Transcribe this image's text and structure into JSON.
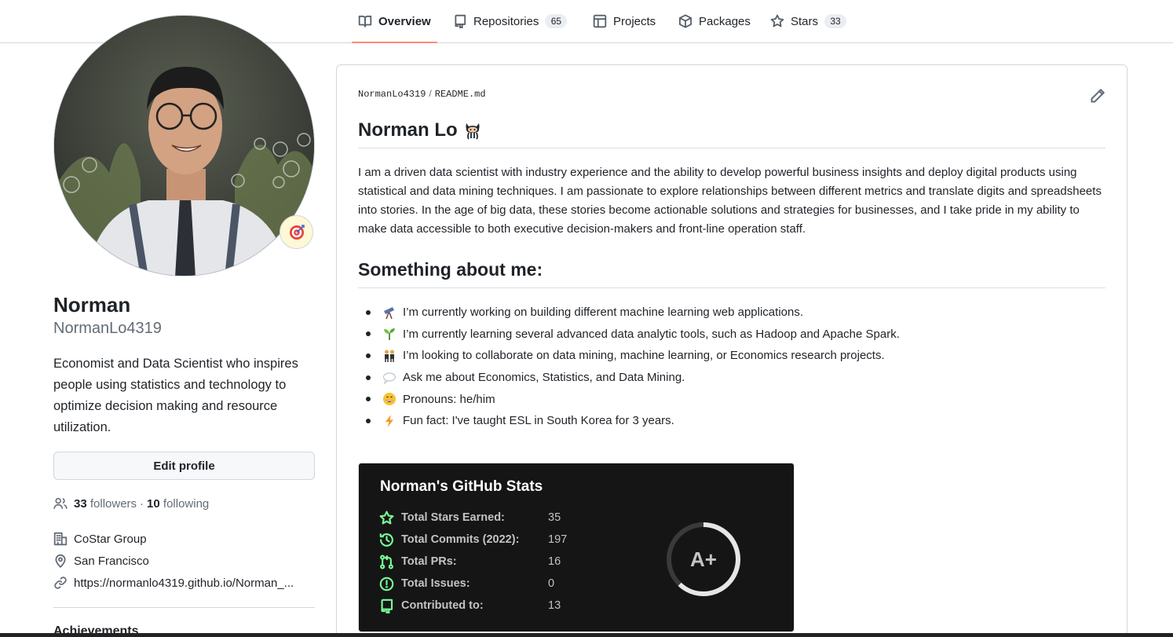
{
  "nav": {
    "tabs": [
      {
        "label": "Overview",
        "icon": "book-icon",
        "count": null,
        "active": true
      },
      {
        "label": "Repositories",
        "icon": "repo-icon",
        "count": "65",
        "active": false
      },
      {
        "label": "Projects",
        "icon": "table-icon",
        "count": null,
        "active": false
      },
      {
        "label": "Packages",
        "icon": "package-icon",
        "count": null,
        "active": false
      },
      {
        "label": "Stars",
        "icon": "star-icon",
        "count": "33",
        "active": false
      }
    ]
  },
  "profile": {
    "name": "Norman",
    "username": "NormanLo4319",
    "status_icon": "dart-target-icon",
    "bio": "Economist and Data Scientist who inspires people using statistics and technology to optimize decision making and resource utilization.",
    "edit_button": "Edit profile",
    "followers_count": "33",
    "followers_label": "followers",
    "separator": "·",
    "following_count": "10",
    "following_label": "following",
    "company": "CoStar Group",
    "location": "San Francisco",
    "website": "https://normanlo4319.github.io/Norman_...",
    "achievements_heading": "Achievements"
  },
  "readme": {
    "path_user": "NormanLo4319",
    "path_sep": "/",
    "path_file": "README.md",
    "heading": "Norman Lo",
    "heading_icon": "octocat-icon",
    "intro": "I am a driven data scientist with industry experience and the ability to develop powerful business insights and deploy digital products using statistical and data mining techniques. I am passionate to explore relationships between different metrics and translate digits and spreadsheets into stories. In the age of big data, these stories become actionable solutions and strategies for businesses, and I take pride in my ability to make data accessible to both executive decision-makers and front-line operation staff.",
    "about_heading": "Something about me:",
    "about_items": [
      {
        "icon": "telescope-icon",
        "text": "I’m currently working on building different machine learning web applications."
      },
      {
        "icon": "seedling-icon",
        "text": "I’m currently learning several advanced data analytic tools, such as Hadoop and Apache Spark."
      },
      {
        "icon": "people-icon",
        "text": "I’m looking to collaborate on data mining, machine learning, or Economics research projects."
      },
      {
        "icon": "speech-balloon-icon",
        "text": "Ask me about Economics, Statistics, and Data Mining."
      },
      {
        "icon": "grinning-face-icon",
        "text": "Pronouns: he/him"
      },
      {
        "icon": "lightning-icon",
        "text": "Fun fact: I've taught ESL in South Korea for 3 years."
      }
    ]
  },
  "stats": {
    "title": "Norman's GitHub Stats",
    "rows": [
      {
        "icon": "star-icon",
        "label": "Total Stars Earned:",
        "value": "35"
      },
      {
        "icon": "history-icon",
        "label": "Total Commits (2022):",
        "value": "197"
      },
      {
        "icon": "pull-request-icon",
        "label": "Total PRs:",
        "value": "16"
      },
      {
        "icon": "issue-icon",
        "label": "Total Issues:",
        "value": "0"
      },
      {
        "icon": "repo-icon",
        "label": "Contributed to:",
        "value": "13"
      }
    ],
    "grade": "A+",
    "grade_ring_fraction": 0.62,
    "colors": {
      "background": "#151515",
      "icon": "#79ff97",
      "text": "#c3c3c3",
      "title": "#ffffff"
    }
  },
  "colors": {
    "active_tab_underline": "#fd8c73",
    "text": "#1f2328",
    "muted": "#636c76",
    "border": "#d0d7de"
  }
}
